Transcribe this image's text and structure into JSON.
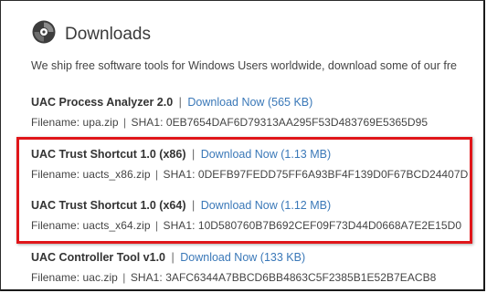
{
  "section": {
    "title": "Downloads",
    "intro": "We ship free software tools for Windows Users worldwide, download some of our fre"
  },
  "items": [
    {
      "name": "UAC Process Analyzer 2.0",
      "link_label": "Download Now",
      "size": "(565 KB)",
      "filename_label": "Filename:",
      "filename": "upa.zip",
      "sha_label": "SHA1:",
      "sha1": "0EB7654DAF6D79313AA295F53D483769E5365D95"
    },
    {
      "name": "UAC Trust Shortcut 1.0 (x86)",
      "link_label": "Download Now",
      "size": "(1.13 MB)",
      "filename_label": "Filename:",
      "filename": "uacts_x86.zip",
      "sha_label": "SHA1:",
      "sha1": "0DEFB97FEDD75FF6A93BF4F139D0F67BCD24407D"
    },
    {
      "name": "UAC Trust Shortcut 1.0 (x64)",
      "link_label": "Download Now",
      "size": "(1.12 MB)",
      "filename_label": "Filename:",
      "filename": "uacts_x64.zip",
      "sha_label": "SHA1:",
      "sha1": "10D580760B7B692CEF09F73D44D0668A7E2E15D0"
    },
    {
      "name": "UAC Controller Tool v1.0",
      "link_label": "Download Now",
      "size": "(133 KB)",
      "filename_label": "Filename:",
      "filename": "uac.zip",
      "sha_label": "SHA1:",
      "sha1": "3AFC6344A7BBCD6BB4863C5F2385B1E52B7EACB8"
    }
  ],
  "colors": {
    "link": "#3a78b8",
    "highlight_border": "#e0161a",
    "text": "#333333"
  },
  "icons": {
    "section_icon": "disc-icon"
  }
}
